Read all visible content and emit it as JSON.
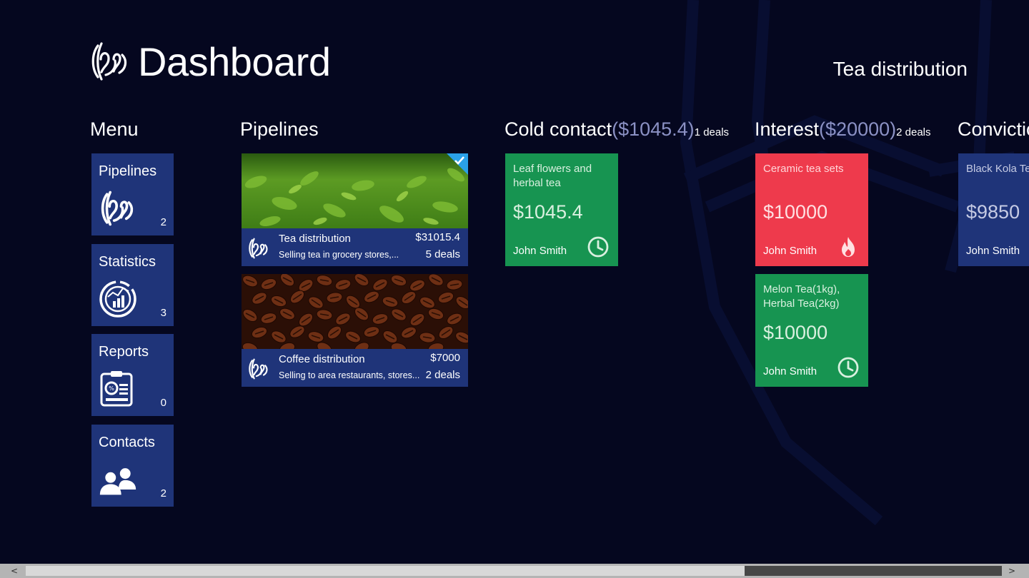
{
  "header": {
    "title": "Dashboard",
    "current_pipeline": "Tea distribution"
  },
  "menu": {
    "heading": "Menu",
    "items": [
      {
        "label": "Pipelines",
        "count": "2",
        "icon": "pipelines-logo-icon"
      },
      {
        "label": "Statistics",
        "count": "3",
        "icon": "statistics-chart-icon"
      },
      {
        "label": "Reports",
        "count": "0",
        "icon": "report-clipboard-icon"
      },
      {
        "label": "Contacts",
        "count": "2",
        "icon": "contacts-people-icon"
      }
    ]
  },
  "pipelines": {
    "heading": "Pipelines",
    "items": [
      {
        "name": "Tea distribution",
        "description": "Selling tea in grocery stores,...",
        "amount": "$31015.4",
        "deals": "5 deals",
        "selected": true,
        "photo": "green tea leaves"
      },
      {
        "name": "Coffee distribution",
        "description": "Selling to area restaurants, stores...",
        "amount": "$7000",
        "deals": "2 deals",
        "selected": false,
        "photo": "coffee beans"
      }
    ]
  },
  "stages": [
    {
      "name": "Cold contact",
      "amount": "($1045.4)",
      "deals": "1 deals",
      "cards": [
        {
          "title": "Leaf flowers and herbal tea",
          "amount": "$1045.4",
          "owner": "John Smith",
          "color": "#179451",
          "status_icon": "clock-icon"
        }
      ]
    },
    {
      "name": "Interest",
      "amount": "($20000)",
      "deals": "2 deals",
      "cards": [
        {
          "title": "Ceramic tea sets",
          "amount": "$10000",
          "owner": "John Smith",
          "color": "#ee3a4c",
          "status_icon": "flame-icon"
        },
        {
          "title": "Melon Tea(1kg), Herbal Tea(2kg)",
          "amount": "$10000",
          "owner": "John Smith",
          "color": "#179451",
          "status_icon": "clock-icon"
        }
      ]
    },
    {
      "name": "Convictio",
      "cards": [
        {
          "title": "Black Kola Te",
          "amount": "$9850",
          "owner": "John Smith",
          "color": "#1f3479"
        }
      ]
    }
  ],
  "scrollbar": {
    "left_arrow": "<",
    "right_arrow": ">"
  }
}
